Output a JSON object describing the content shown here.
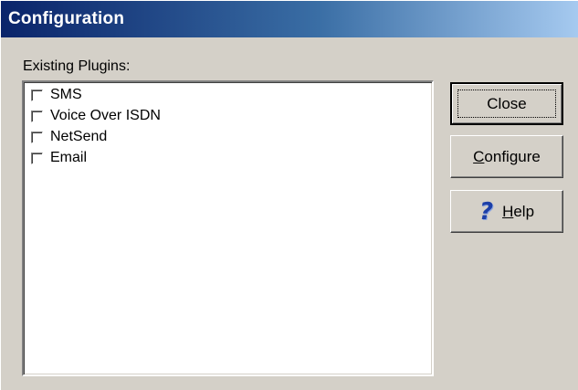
{
  "window": {
    "title": "Configuration"
  },
  "plugins": {
    "label": "Existing Plugins:",
    "items": [
      {
        "label": "SMS",
        "checked": false
      },
      {
        "label": "Voice Over ISDN",
        "checked": false
      },
      {
        "label": "NetSend",
        "checked": false
      },
      {
        "label": "Email",
        "checked": false
      }
    ]
  },
  "buttons": {
    "close": {
      "label": "Close"
    },
    "configure": {
      "mnemonic": "C",
      "rest": "onfigure"
    },
    "help": {
      "mnemonic": "H",
      "rest": "elp",
      "icon": "question-mark-icon"
    }
  },
  "colors": {
    "title_gradient_start": "#0a246a",
    "title_gradient_end": "#a6caf0",
    "face": "#d4d0c8",
    "help_icon": "#1c3fa8"
  }
}
